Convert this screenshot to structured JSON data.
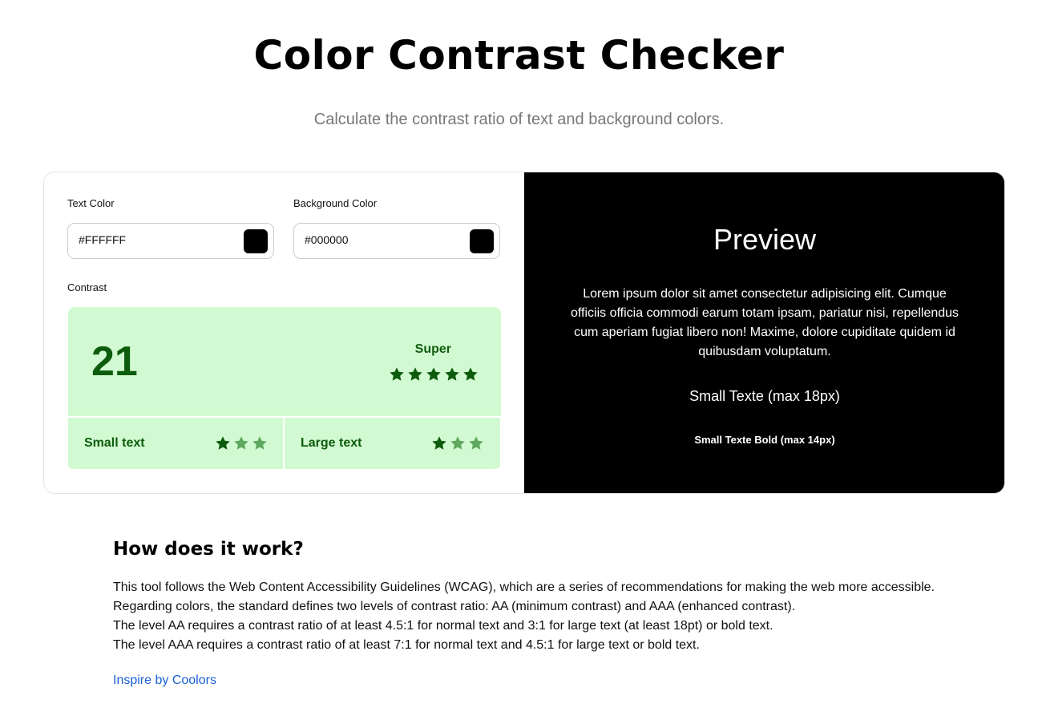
{
  "header": {
    "title": "Color Contrast Checker",
    "subtitle": "Calculate the contrast ratio of text and background colors."
  },
  "inputs": {
    "text_color_label": "Text Color",
    "text_color_value": "#FFFFFF",
    "text_swatch_color": "#000000",
    "background_color_label": "Background Color",
    "background_color_value": "#000000",
    "background_swatch_color": "#000000"
  },
  "contrast": {
    "label": "Contrast",
    "ratio": "21",
    "rating": "Super",
    "rating_stars": 5,
    "small_text_label": "Small text",
    "small_text_stars": 3,
    "large_text_label": "Large text",
    "large_text_stars": 3,
    "colors": {
      "box_bg": "#d2fad2",
      "text": "#0d5c0d",
      "star_full": "#0d5c0d",
      "star_faded": "#5fa85f"
    }
  },
  "preview": {
    "title": "Preview",
    "body": "Lorem ipsum dolor sit amet consectetur adipisicing elit. Cumque officiis officia commodi earum totam ipsam, pariatur nisi, repellendus cum aperiam fugiat libero non! Maxime, dolore cupiditate quidem id quibusdam voluptatum.",
    "small_text": "Small Texte (max 18px)",
    "small_bold_text": "Small Texte Bold (max 14px)",
    "background": "#000000",
    "foreground": "#FFFFFF"
  },
  "how": {
    "title": "How does it work?",
    "lines": [
      "This tool follows the Web Content Accessibility Guidelines (WCAG), which are a series of recommendations for making the web more accessible.",
      "Regarding colors, the standard defines two levels of contrast ratio: AA (minimum contrast) and AAA (enhanced contrast).",
      "The level AA requires a contrast ratio of at least 4.5:1 for normal text and 3:1 for large text (at least 18pt) or bold text.",
      "The level AAA requires a contrast ratio of at least 7:1 for normal text and 4.5:1 for large text or bold text."
    ],
    "link_text": "Inspire by Coolors"
  }
}
